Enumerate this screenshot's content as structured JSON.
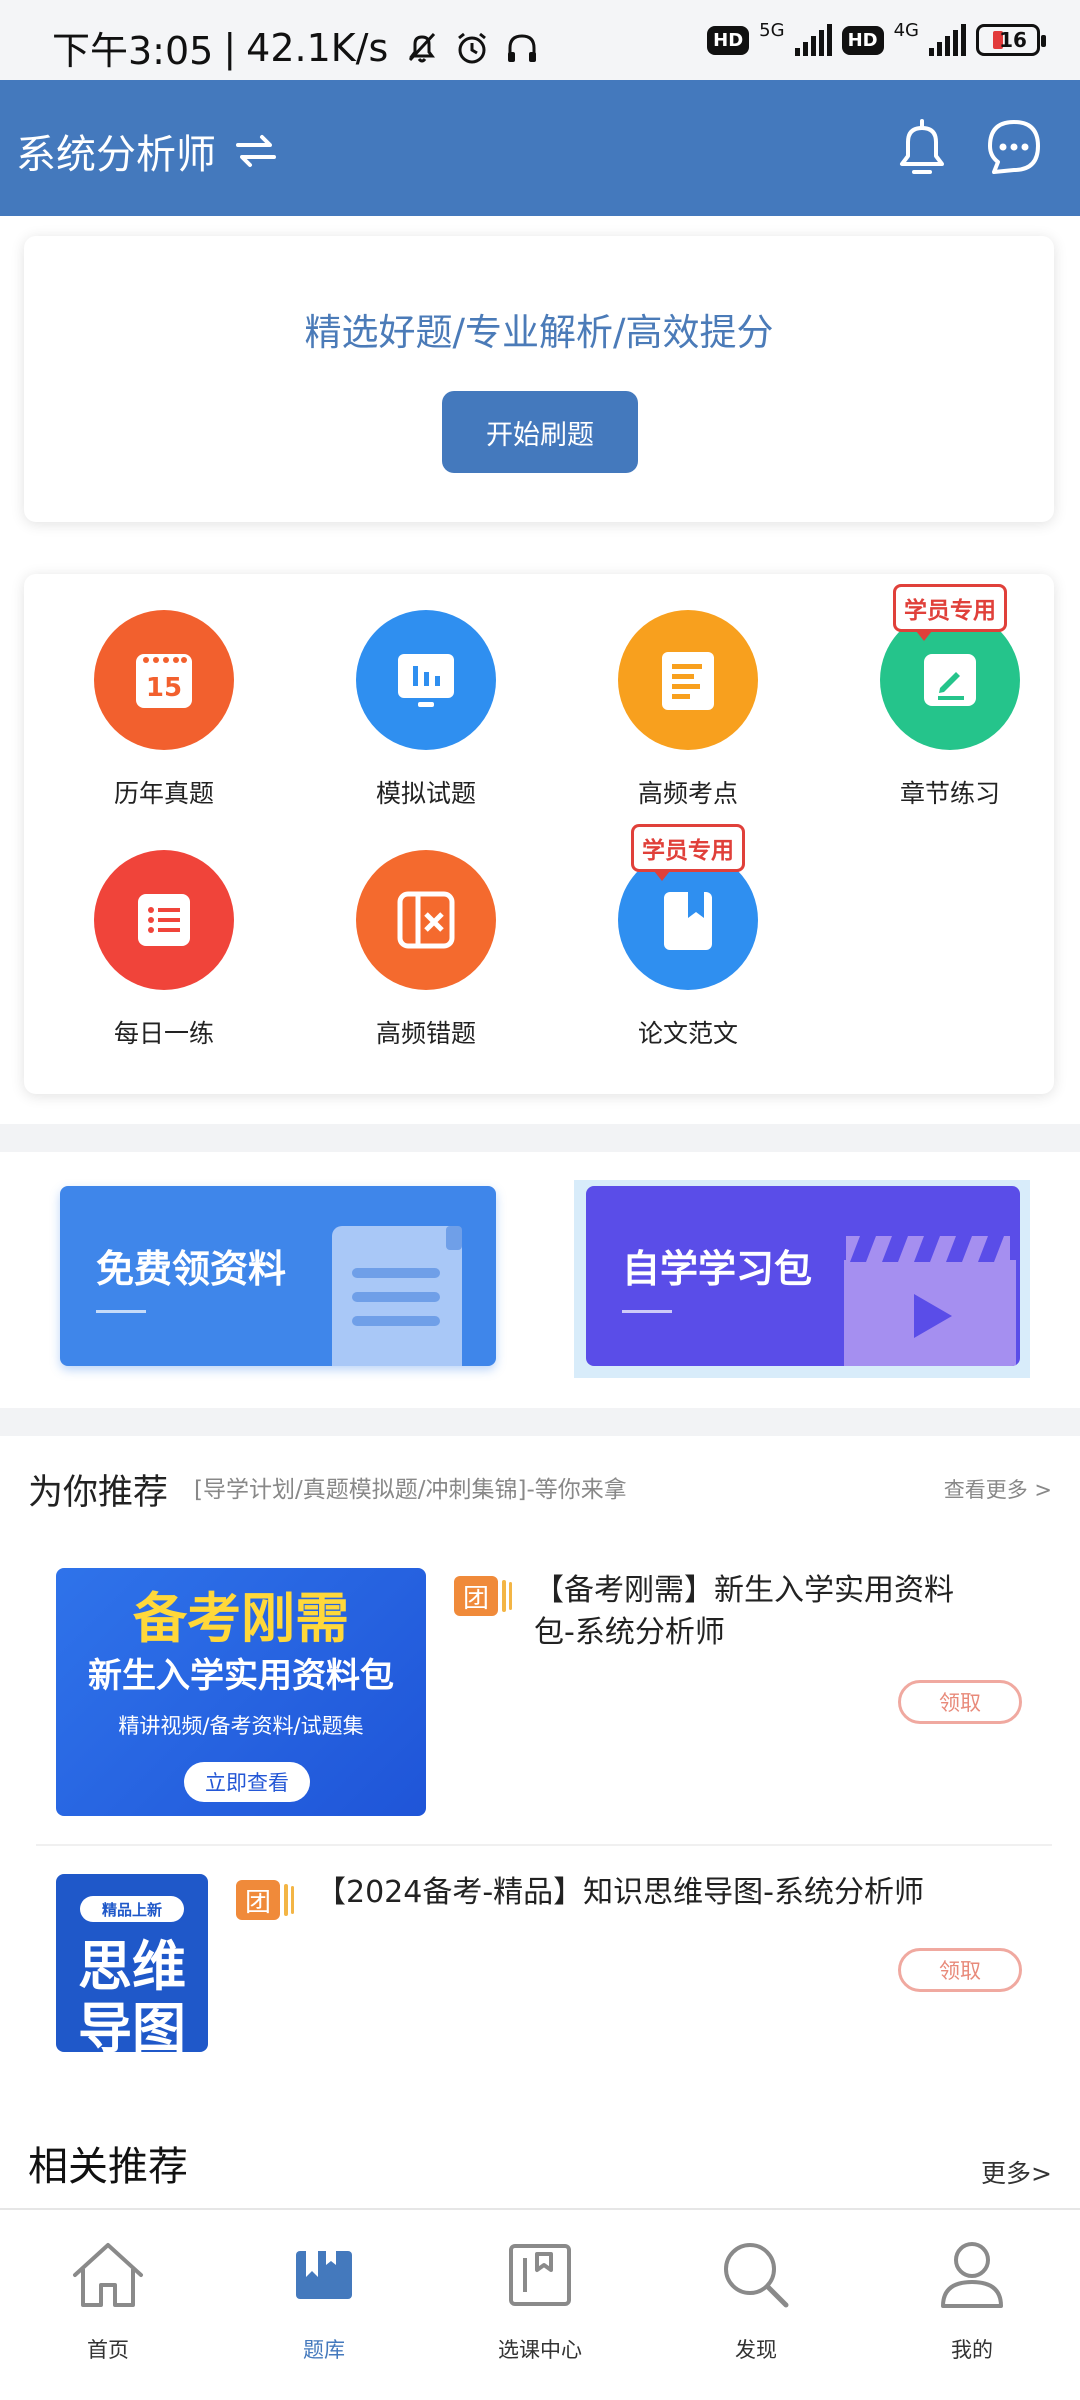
{
  "status_bar": {
    "time": "下午3:05",
    "speed": "42.1K/s",
    "network1": "5G",
    "network2": "4G",
    "hd": "HD",
    "battery": "16"
  },
  "header": {
    "title": "系统分析师",
    "switch_icon": "swap-icon",
    "bell_icon": "bell-icon",
    "message_icon": "chat-icon"
  },
  "hero": {
    "slogan": "精选好题/专业解析/高效提分",
    "start_button": "开始刷题"
  },
  "grid": [
    {
      "label": "历年真题",
      "icon": "calendar-icon",
      "color": "#f2602e",
      "tag": ""
    },
    {
      "label": "模拟试题",
      "icon": "screen-chart-icon",
      "color": "#2f8ff0",
      "tag": ""
    },
    {
      "label": "高频考点",
      "icon": "document-icon",
      "color": "#f8a01e",
      "tag": ""
    },
    {
      "label": "章节练习",
      "icon": "edit-icon",
      "color": "#25c48b",
      "tag": "学员专用"
    },
    {
      "label": "每日一练",
      "icon": "list-icon",
      "color": "#f0443a",
      "tag": ""
    },
    {
      "label": "高频错题",
      "icon": "error-book-icon",
      "color": "#f46a2e",
      "tag": ""
    },
    {
      "label": "论文范文",
      "icon": "bookmark-book-icon",
      "color": "#2f8ff0",
      "tag": "学员专用"
    }
  ],
  "banners": [
    {
      "text": "免费领资料",
      "icon": "scroll-icon",
      "color": "#3f86ea"
    },
    {
      "text": "自学学习包",
      "icon": "video-clapper-icon",
      "color": "#5a4de8"
    }
  ],
  "recommend": {
    "title": "为你推荐",
    "subtitle": "[导学计划/真题模拟题/冲刺集锦]-等你来拿",
    "more": "查看更多 >",
    "items": [
      {
        "badge": "团",
        "title": "【备考刚需】新生入学实用资料包-系统分析师",
        "claim": "领取",
        "thumb": {
          "headline": "备考刚需",
          "subline": "新生入学实用资料包",
          "caption": "精讲视频/备考资料/试题集",
          "button": "立即查看"
        }
      },
      {
        "badge": "团",
        "title": "【2024备考-精品】知识思维导图-系统分析师",
        "claim": "领取",
        "thumb": {
          "tag": "精品上新",
          "line1": "思维",
          "line2": "导图"
        }
      }
    ]
  },
  "related": {
    "title": "相关推荐",
    "more": "更多>"
  },
  "bottom_nav": [
    {
      "label": "首页",
      "icon": "home-icon",
      "active": false
    },
    {
      "label": "题库",
      "icon": "question-bank-icon",
      "active": true
    },
    {
      "label": "选课中心",
      "icon": "course-center-icon",
      "active": false
    },
    {
      "label": "发现",
      "icon": "search-icon",
      "active": false
    },
    {
      "label": "我的",
      "icon": "user-icon",
      "active": false
    }
  ],
  "colors": {
    "primary": "#4479bd",
    "tag_red": "#e0403a",
    "claim": "#e88a7a"
  }
}
